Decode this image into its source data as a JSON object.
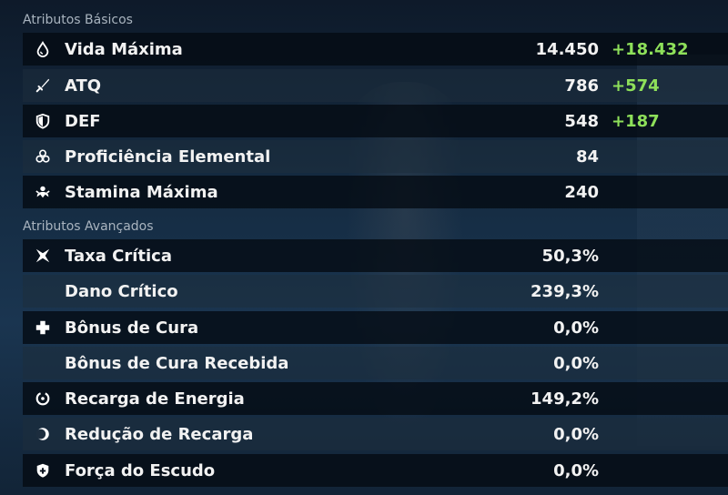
{
  "sections": {
    "basic_title": "Atributos Básicos",
    "advanced_title": "Atributos Avançados"
  },
  "colors": {
    "bonus": "#8ee05a",
    "text": "#f2f2f2",
    "section_title": "#a9b4bf"
  },
  "basic_stats": [
    {
      "icon": "droplet-icon",
      "label": "Vida Máxima",
      "value": "14.450",
      "bonus": "+18.432"
    },
    {
      "icon": "sword-icon",
      "label": "ATQ",
      "value": "786",
      "bonus": "+574"
    },
    {
      "icon": "shield-icon",
      "label": "DEF",
      "value": "548",
      "bonus": "+187"
    },
    {
      "icon": "elemental-mastery-icon",
      "label": "Proficiência Elemental",
      "value": "84",
      "bonus": ""
    },
    {
      "icon": "stamina-icon",
      "label": "Stamina Máxima",
      "value": "240",
      "bonus": ""
    }
  ],
  "advanced_stats": [
    {
      "icon": "crit-rate-icon",
      "label": "Taxa Crítica",
      "value": "50,3%"
    },
    {
      "icon": "",
      "label": "Dano Crítico",
      "value": "239,3%"
    },
    {
      "icon": "healing-cross-icon",
      "label": "Bônus de Cura",
      "value": "0,0%"
    },
    {
      "icon": "",
      "label": "Bônus de Cura Recebida",
      "value": "0,0%"
    },
    {
      "icon": "energy-recharge-icon",
      "label": "Recarga de Energia",
      "value": "149,2%"
    },
    {
      "icon": "cooldown-reduction-icon",
      "label": "Redução de Recarga",
      "value": "0,0%"
    },
    {
      "icon": "shield-strength-icon",
      "label": "Força do Escudo",
      "value": "0,0%"
    }
  ]
}
